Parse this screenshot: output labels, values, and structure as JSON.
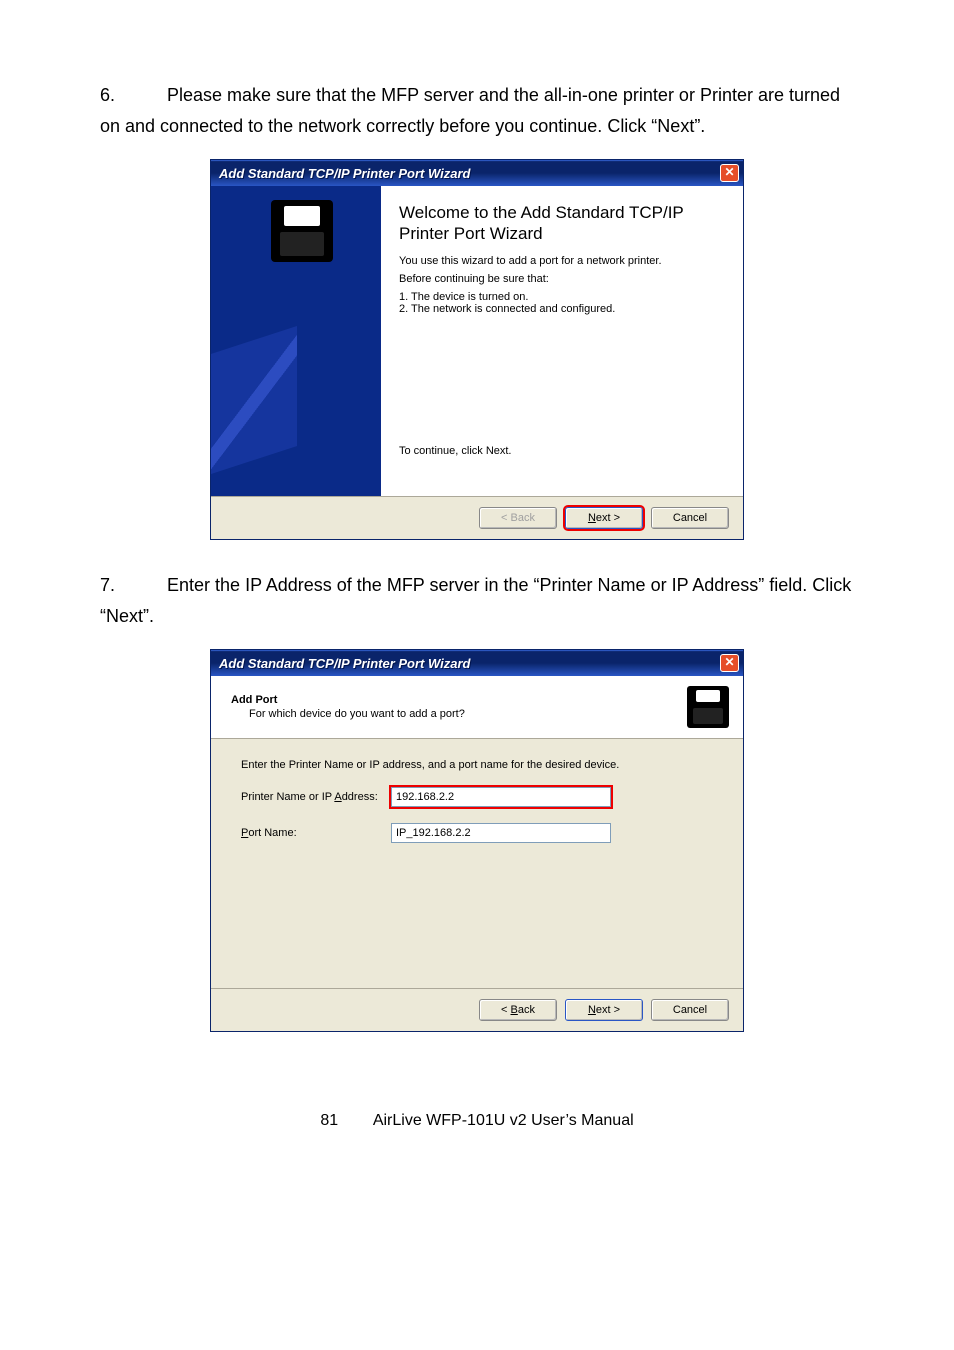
{
  "step6": {
    "number": "6.",
    "text": "Please make sure that the MFP server and the all-in-one printer or Printer are turned on and connected to the network correctly before you continue. Click “Next”."
  },
  "step7": {
    "number": "7.",
    "text": "Enter the IP Address of the MFP server in the “Printer Name or IP Address” field. Click “Next”."
  },
  "wizard1": {
    "title": "Add Standard TCP/IP Printer Port Wizard",
    "heading": "Welcome to the Add Standard TCP/IP Printer Port Wizard",
    "line1": "You use this wizard to add a port for a network printer.",
    "before": "Before continuing be sure that:",
    "b1": "1.  The device is turned on.",
    "b2": "2.  The network is connected and configured.",
    "cont": "To continue, click Next.",
    "back": "< Back",
    "next": "Next >",
    "next_ul": "N",
    "cancel": "Cancel"
  },
  "wizard2": {
    "title": "Add Standard TCP/IP Printer Port Wizard",
    "h1": "Add Port",
    "h2": "For which device do you want to add a port?",
    "intro": "Enter the Printer Name or IP address, and a port name for the desired device.",
    "label_printer_pre": "Printer Name or IP ",
    "label_printer_ul": "A",
    "label_printer_post": "ddress:",
    "label_port_ul": "P",
    "label_port_post": "ort Name:",
    "val_printer": "192.168.2.2",
    "val_port": "IP_192.168.2.2",
    "back_ul": "B",
    "back_post": "ack",
    "back_pre": "< ",
    "next_ul": "N",
    "next_post": "ext >",
    "cancel": "Cancel"
  },
  "footer": {
    "page": "81",
    "doc": "AirLive WFP-101U v2 User’s Manual"
  }
}
